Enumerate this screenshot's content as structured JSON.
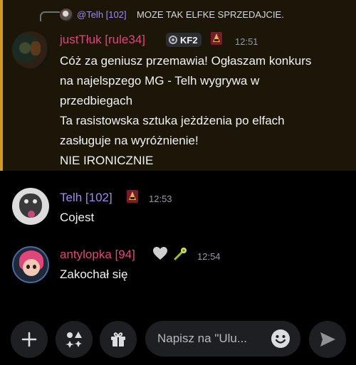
{
  "reply_preview": {
    "author": "@Telh [102]",
    "text": "MOZE TAK ELFKE SPRZEDAJCIE."
  },
  "messages": [
    {
      "author": "justTłuk [rule34]",
      "tag": "KF2",
      "time": "12:51",
      "lines": [
        "Cóż za geniusz przemawia! Ogłaszam konkurs",
        "na najelspzego MG - Telh wygrywa w",
        "przedbiegach",
        "Ta rasistowska sztuka jeżdżenia po elfach",
        "zasługuje na wyróżnienie!",
        "NIE IRONICZNIE"
      ],
      "highlighted": true
    },
    {
      "author": "Telh [102]",
      "time": "12:53",
      "lines": [
        "Cojest"
      ]
    },
    {
      "author": "antylopka [94]",
      "time": "12:54",
      "lines": [
        "Zakochał się"
      ]
    }
  ],
  "composer": {
    "placeholder": "Napisz na \"Ulu..."
  },
  "colors": {
    "background": "#000000",
    "mention_highlight": "#1c1608",
    "mention_bar": "#d29a1f",
    "pink_role": "#e0457b",
    "purple_role": "#9b8cf0"
  },
  "icons": {
    "plus": "plus-icon",
    "apps": "apps-icon",
    "gift": "gift-icon",
    "emoji": "emoji-icon",
    "send": "send-icon"
  }
}
